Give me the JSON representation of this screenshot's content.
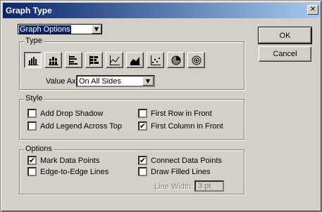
{
  "window": {
    "title": "Graph Type"
  },
  "buttons": {
    "ok": "OK",
    "cancel": "Cancel"
  },
  "section_dropdown": {
    "value": "Graph Options"
  },
  "type_group": {
    "label": "Type",
    "buttons": [
      {
        "name": "grouped-column",
        "pressed": true
      },
      {
        "name": "stacked-column",
        "pressed": false
      },
      {
        "name": "grouped-bar",
        "pressed": false
      },
      {
        "name": "stacked-bar",
        "pressed": false
      },
      {
        "name": "line",
        "pressed": false
      },
      {
        "name": "area",
        "pressed": false
      },
      {
        "name": "scatter",
        "pressed": false
      },
      {
        "name": "pie",
        "pressed": false
      },
      {
        "name": "radar",
        "pressed": false
      }
    ],
    "value_axis_label": "Value Axis:",
    "value_axis_value": "On All Sides"
  },
  "style_group": {
    "label": "Style",
    "add_drop_shadow": {
      "label": "Add Drop Shadow",
      "checked": false
    },
    "add_legend": {
      "label": "Add Legend Across Top",
      "checked": false
    },
    "first_row_front": {
      "label": "First Row in Front",
      "checked": false
    },
    "first_column_front": {
      "label": "First Column in Front",
      "checked": true
    }
  },
  "options_group": {
    "label": "Options",
    "mark_data_points": {
      "label": "Mark Data Points",
      "checked": true
    },
    "edge_to_edge": {
      "label": "Edge-to-Edge Lines",
      "checked": false
    },
    "connect_data_points": {
      "label": "Connect Data Points",
      "checked": true
    },
    "draw_filled_lines": {
      "label": "Draw Filled Lines",
      "checked": false
    },
    "line_width_label": "Line Width:",
    "line_width_value": "3 pt"
  }
}
